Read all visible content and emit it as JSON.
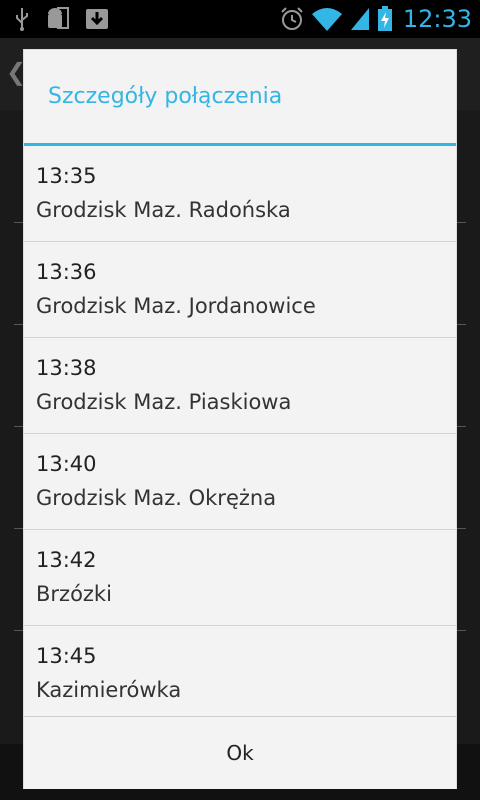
{
  "status_bar": {
    "time": "12:33",
    "icons": [
      "usb-icon",
      "android-debug-icon",
      "download-icon",
      "alarm-icon",
      "wifi-icon",
      "signal-icon",
      "battery-charging-icon"
    ]
  },
  "dialog": {
    "title": "Szczegóły połączenia",
    "stops": [
      {
        "time": "13:35",
        "name": "Grodzisk Maz. Radońska"
      },
      {
        "time": "13:36",
        "name": "Grodzisk Maz. Jordanowice"
      },
      {
        "time": "13:38",
        "name": "Grodzisk Maz. Piaskiowa"
      },
      {
        "time": "13:40",
        "name": "Grodzisk Maz. Okrężna"
      },
      {
        "time": "13:42",
        "name": "Brzózki"
      },
      {
        "time": "13:45",
        "name": "Kazimierówka"
      }
    ],
    "ok_label": "Ok"
  },
  "colors": {
    "accent": "#33b5e5",
    "dialog_bg": "#f3f3f3"
  }
}
